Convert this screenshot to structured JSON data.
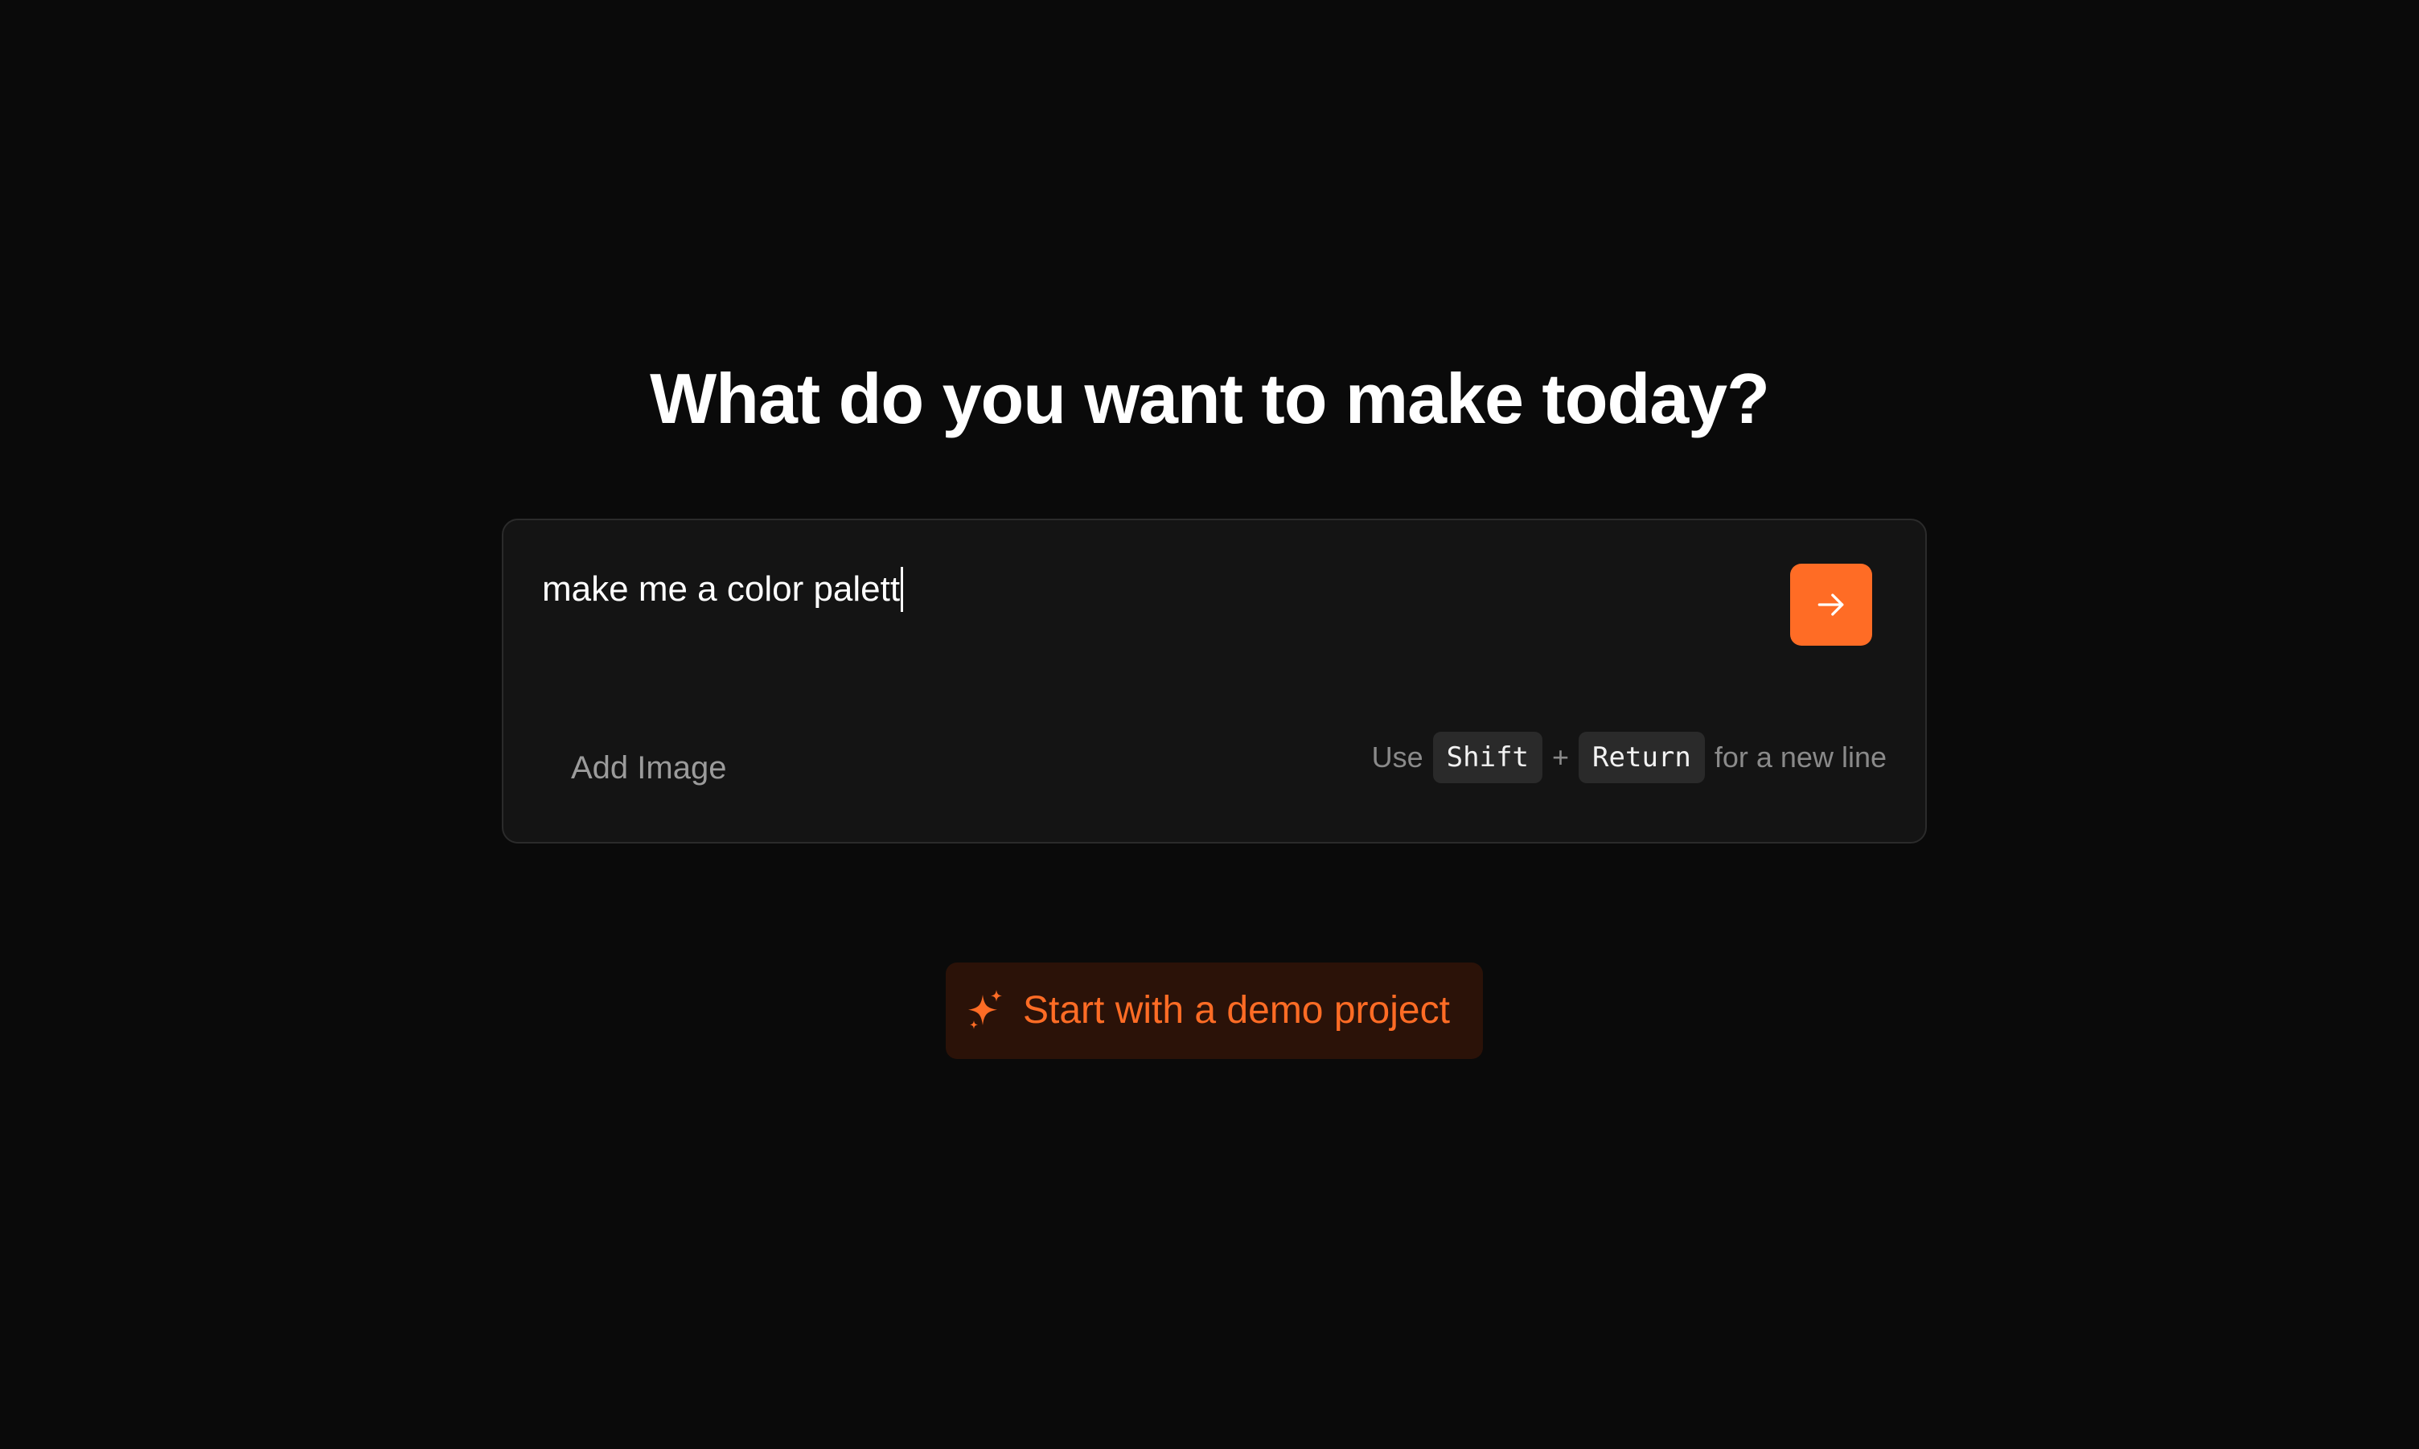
{
  "main": {
    "headline": "What do you want to make today?"
  },
  "composer": {
    "prompt_value": "make me a color palett",
    "add_image_label": "Add Image",
    "hint": {
      "prefix": "Use",
      "key1": "Shift",
      "plus": "+",
      "key2": "Return",
      "suffix": "for a new line"
    },
    "send_icon": "arrow-right-icon"
  },
  "demo": {
    "label": "Start with a demo project",
    "icon": "sparkle-icon"
  },
  "colors": {
    "background": "#0a0a0a",
    "composer_bg": "#141414",
    "accent": "#ff6c25",
    "demo_bg": "#2b1208"
  }
}
